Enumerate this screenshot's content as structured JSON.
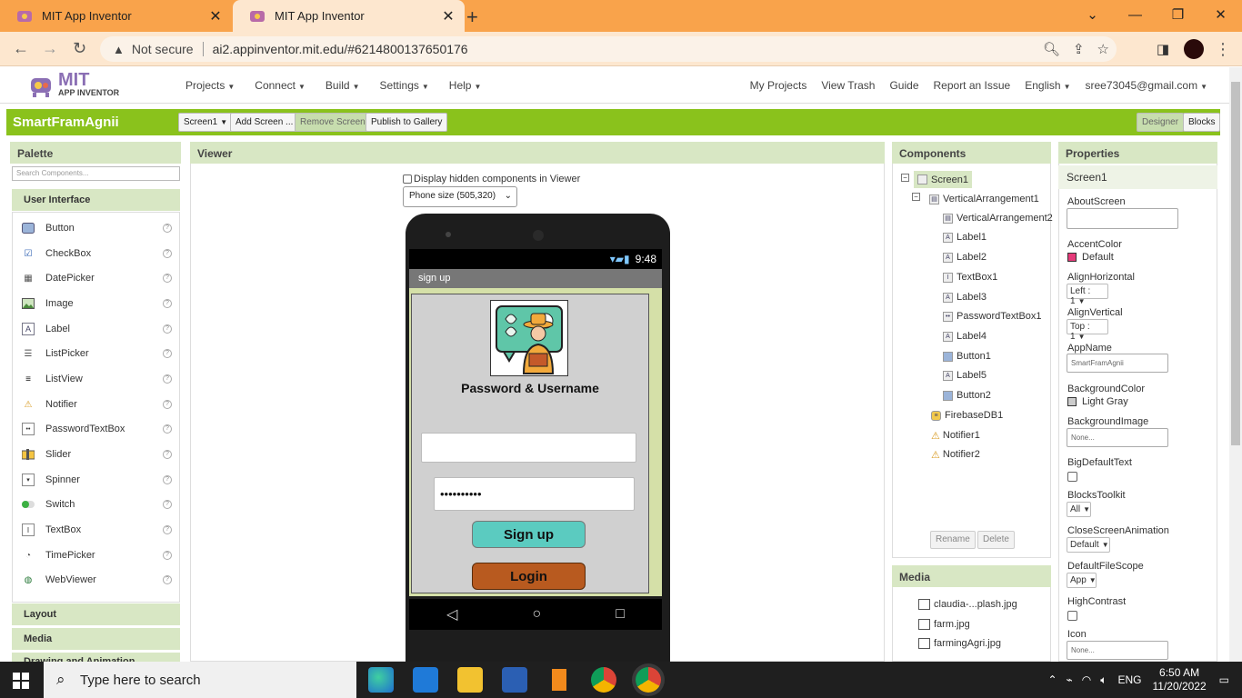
{
  "browser": {
    "tabs": [
      {
        "title": "MIT App Inventor"
      },
      {
        "title": "MIT App Inventor"
      }
    ],
    "not_secure": "Not secure",
    "url": "ai2.appinventor.mit.edu/#6214800137650176"
  },
  "app_header": {
    "logo_main": "MIT",
    "logo_sub": "APP INVENTOR",
    "menu": [
      "Projects",
      "Connect",
      "Build",
      "Settings",
      "Help"
    ],
    "right_links": [
      "My Projects",
      "View Trash",
      "Guide",
      "Report an Issue",
      "English",
      "sree73045@gmail.com"
    ]
  },
  "project_bar": {
    "name": "SmartFramAgnii",
    "screen_select": "Screen1",
    "add_screen": "Add Screen ...",
    "remove_screen": "Remove Screen",
    "publish": "Publish to Gallery",
    "designer": "Designer",
    "blocks": "Blocks"
  },
  "palette": {
    "title": "Palette",
    "search_placeholder": "Search Components...",
    "ui_category": "User Interface",
    "items": [
      "Button",
      "CheckBox",
      "DatePicker",
      "Image",
      "Label",
      "ListPicker",
      "ListView",
      "Notifier",
      "PasswordTextBox",
      "Slider",
      "Spinner",
      "Switch",
      "TextBox",
      "TimePicker",
      "WebViewer"
    ],
    "categories": [
      "Layout",
      "Media",
      "Drawing and Animation"
    ]
  },
  "viewer": {
    "title": "Viewer",
    "hidden_checkbox": "Display hidden components in Viewer",
    "phone_size": "Phone size (505,320)",
    "time": "9:48",
    "screen_title": "sign up",
    "label": "Password & Username",
    "password_value": "••••••••••",
    "button1": "Sign up",
    "button2": "Login"
  },
  "components": {
    "title": "Components",
    "tree": [
      "Screen1",
      "VerticalArrangement1",
      "VerticalArrangement2",
      "Label1",
      "Label2",
      "TextBox1",
      "Label3",
      "PasswordTextBox1",
      "Label4",
      "Button1",
      "Label5",
      "Button2",
      "FirebaseDB1",
      "Notifier1",
      "Notifier2"
    ],
    "rename": "Rename",
    "delete": "Delete"
  },
  "media": {
    "title": "Media",
    "files": [
      "claudia-...plash.jpg",
      "farm.jpg",
      "farmingAgri.jpg"
    ]
  },
  "properties": {
    "title": "Properties",
    "component": "Screen1",
    "about_screen": "AboutScreen",
    "accent_color": "AccentColor",
    "accent_value": "Default",
    "accent_hex": "#e63b7a",
    "align_h": "AlignHorizontal",
    "align_h_value": "Left : 1",
    "align_v": "AlignVertical",
    "align_v_value": "Top : 1",
    "app_name": "AppName",
    "app_name_value": "SmartFramAgnii",
    "bg_color": "BackgroundColor",
    "bg_color_value": "Light Gray",
    "bg_image": "BackgroundImage",
    "bg_image_value": "None...",
    "big_default": "BigDefaultText",
    "blocks_toolkit": "BlocksToolkit",
    "blocks_toolkit_value": "All",
    "close_anim": "CloseScreenAnimation",
    "close_anim_value": "Default",
    "file_scope": "DefaultFileScope",
    "file_scope_value": "App",
    "high_contrast": "HighContrast",
    "icon": "Icon",
    "icon_value": "None..."
  },
  "taskbar": {
    "search": "Type here to search",
    "lang": "ENG",
    "time": "6:50 AM",
    "date": "11/20/2022"
  },
  "colors": {
    "app_green": "#8ac21c",
    "panel_header": "#d8e7c4",
    "browser_orange": "#f9a34b",
    "signup_button": "#5bcbc0",
    "login_button": "#b85a1f"
  }
}
